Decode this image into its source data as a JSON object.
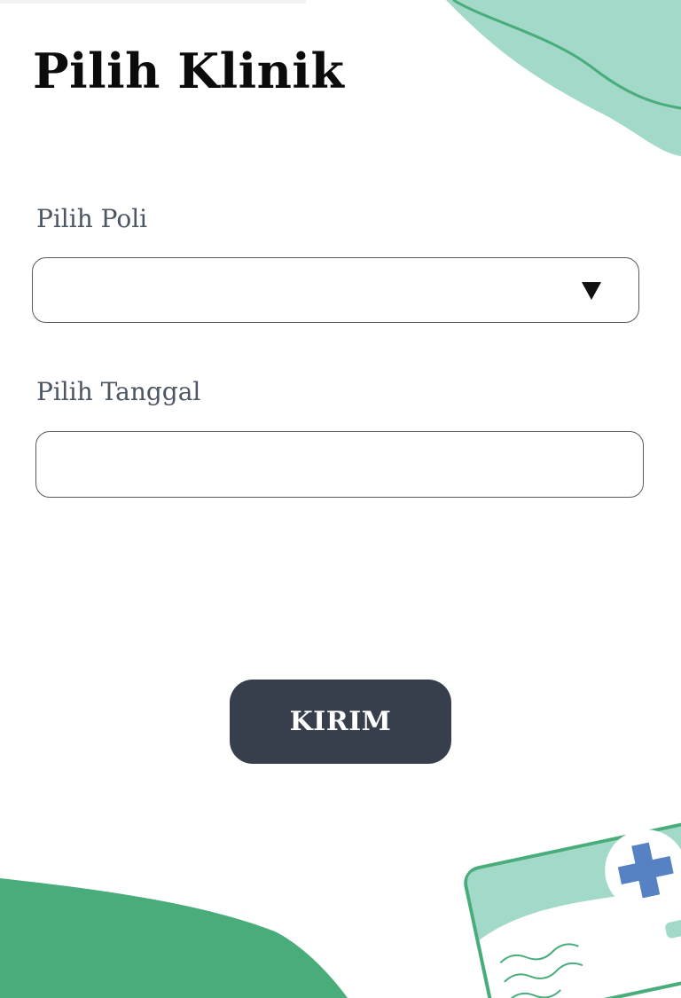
{
  "page": {
    "title": "Pilih Klinik"
  },
  "form": {
    "poli": {
      "label": "Pilih Poli",
      "selected_value": ""
    },
    "tanggal": {
      "label": "Pilih Tanggal",
      "value": ""
    },
    "submit_label": "KIRIM"
  },
  "colors": {
    "accent_light_green": "#a2d9c8",
    "accent_green": "#48ad7b",
    "card_cross_blue": "#5682c4",
    "button_bg": "#363f4b",
    "label_text": "#4c5663"
  },
  "icons": {
    "dropdown": "caret-down-icon",
    "illustration": "medical-card-illustration"
  }
}
